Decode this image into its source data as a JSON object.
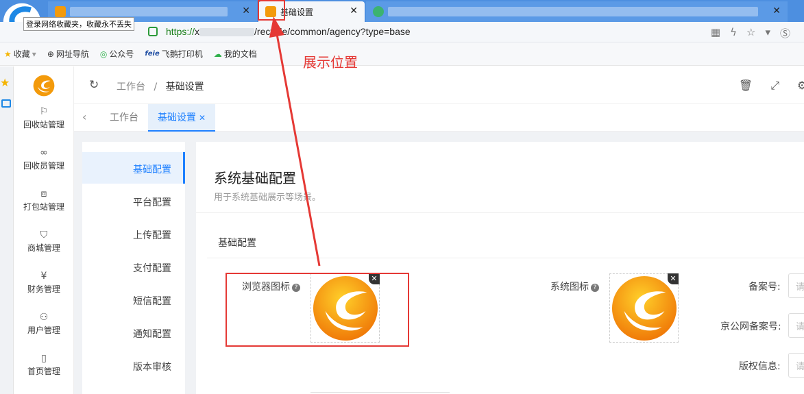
{
  "browser": {
    "tooltip": "登录网络收藏夹，收藏永不丢失",
    "active_tab_title": "基础设置",
    "url_scheme": "https://",
    "url_prefix": "x",
    "url_path": "/recycle/common/agency?type=base",
    "bookmarks": [
      {
        "label": "收藏",
        "icon": "star-icon"
      },
      {
        "label": "网址导航",
        "icon": "globe-icon"
      },
      {
        "label": "公众号",
        "icon": "wechat-icon"
      },
      {
        "label": "飞鹅打印机",
        "icon": "feie-logo"
      },
      {
        "label": "我的文档",
        "icon": "doc-icon"
      }
    ]
  },
  "sidebar": {
    "items": [
      {
        "label": "回收站管理",
        "icon": "flag-icon"
      },
      {
        "label": "回收员管理",
        "icon": "infinity-icon"
      },
      {
        "label": "打包站管理",
        "icon": "box-icon"
      },
      {
        "label": "商城管理",
        "icon": "bag-icon"
      },
      {
        "label": "财务管理",
        "icon": "yen-icon"
      },
      {
        "label": "用户管理",
        "icon": "users-icon"
      },
      {
        "label": "首页管理",
        "icon": "tablet-icon"
      }
    ]
  },
  "header": {
    "crumb_home": "工作台",
    "crumb_sep": "/",
    "crumb_current": "基础设置"
  },
  "tags": {
    "home": "工作台",
    "active": "基础设置"
  },
  "subnav": {
    "items": [
      "基础配置",
      "平台配置",
      "上传配置",
      "支付配置",
      "短信配置",
      "通知配置",
      "版本审核"
    ]
  },
  "main": {
    "title": "系统基础配置",
    "desc": "用于系统基础展示等场景。",
    "section": "基础配置",
    "fields": {
      "favicon_label": "浏览器图标",
      "system_icon_label": "系统图标",
      "icp_label": "备案号:",
      "police_label": "京公网备案号:",
      "copyright_label": "版权信息:",
      "input_placeholder": "请"
    }
  },
  "annotation": {
    "text": "展示位置",
    "color": "#e53935"
  },
  "colors": {
    "accent": "#1e80ff",
    "logo_orange": "#f39a0b"
  }
}
